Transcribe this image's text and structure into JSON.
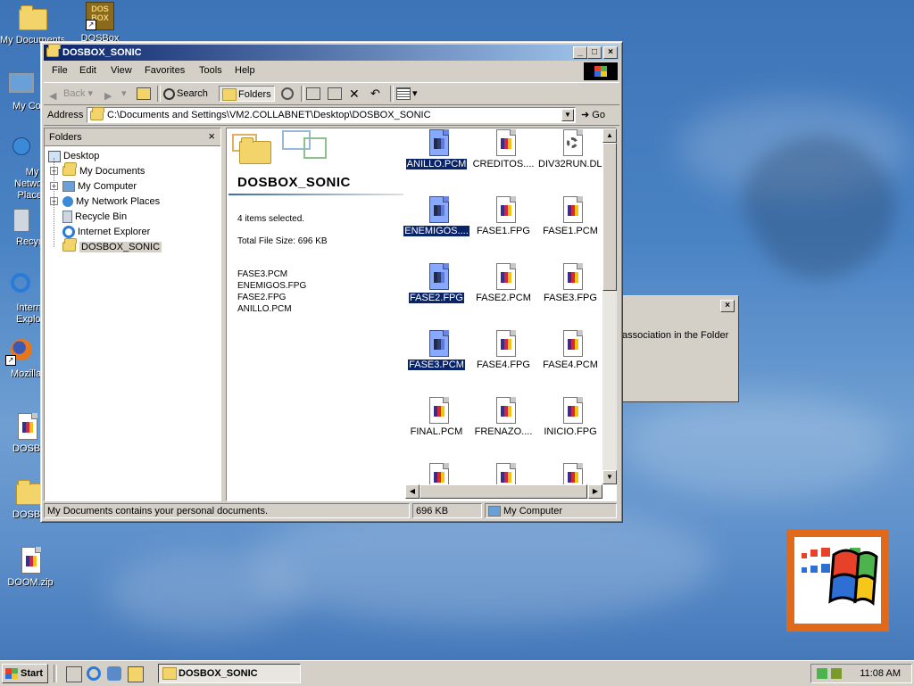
{
  "desktop": {
    "icons": [
      {
        "label": "My Documents"
      },
      {
        "label": "DOSBox"
      },
      {
        "label": "My Computer"
      },
      {
        "label": "My Network Places"
      },
      {
        "label": "Recycle Bin"
      },
      {
        "label": "Internet Explorer"
      },
      {
        "label": "Mozilla Firefox"
      },
      {
        "label": "DOSBOX"
      },
      {
        "label": "DOSBOX"
      },
      {
        "label": "DOOM.zip"
      }
    ]
  },
  "window": {
    "title": "DOSBOX_SONIC",
    "menu": [
      "File",
      "Edit",
      "View",
      "Favorites",
      "Tools",
      "Help"
    ],
    "toolbar": {
      "back": "Back",
      "search": "Search",
      "folders": "Folders"
    },
    "address": {
      "label": "Address",
      "path": "C:\\Documents and Settings\\VM2.COLLABNET\\Desktop\\DOSBOX_SONIC",
      "go": "Go"
    },
    "folders_pane": {
      "title": "Folders",
      "items": [
        {
          "label": "Desktop"
        },
        {
          "label": "My Documents"
        },
        {
          "label": "My Computer"
        },
        {
          "label": "My Network Places"
        },
        {
          "label": "Recycle Bin"
        },
        {
          "label": "Internet Explorer"
        },
        {
          "label": "DOSBOX_SONIC"
        }
      ]
    },
    "info": {
      "folder_name": "DOSBOX_SONIC",
      "selected_count": "4 items selected.",
      "total_size": "Total File Size: 696 KB",
      "selected_files": [
        "FASE3.PCM",
        "ENEMIGOS.FPG",
        "FASE2.FPG",
        "ANILLO.PCM"
      ]
    },
    "files": [
      {
        "name": "ANILLO.PCM",
        "selected": true
      },
      {
        "name": "CREDITOS....",
        "selected": false
      },
      {
        "name": "DIV32RUN.DLL",
        "selected": false
      },
      {
        "name": "ENEMIGOS....",
        "selected": true
      },
      {
        "name": "FASE1.FPG",
        "selected": false
      },
      {
        "name": "FASE1.PCM",
        "selected": false
      },
      {
        "name": "FASE2.FPG",
        "selected": true
      },
      {
        "name": "FASE2.PCM",
        "selected": false
      },
      {
        "name": "FASE3.FPG",
        "selected": false
      },
      {
        "name": "FASE3.PCM",
        "selected": true
      },
      {
        "name": "FASE4.FPG",
        "selected": false
      },
      {
        "name": "FASE4.PCM",
        "selected": false
      },
      {
        "name": "FINAL.PCM",
        "selected": false
      },
      {
        "name": "FRENAZO....",
        "selected": false
      },
      {
        "name": "INICIO.FPG",
        "selected": false
      }
    ],
    "status": {
      "left": "My Documents contains your personal documents.",
      "size": "696 KB",
      "zone": "My Computer"
    }
  },
  "dialog": {
    "text": "association in the Folder"
  },
  "taskbar": {
    "start": "Start",
    "task": "DOSBOX_SONIC",
    "clock": "11:08 AM"
  },
  "colors": {
    "title_active": "#0a246a",
    "selection": "#0a246a",
    "desktop": "#4a83c4",
    "face": "#d4d0c8"
  }
}
